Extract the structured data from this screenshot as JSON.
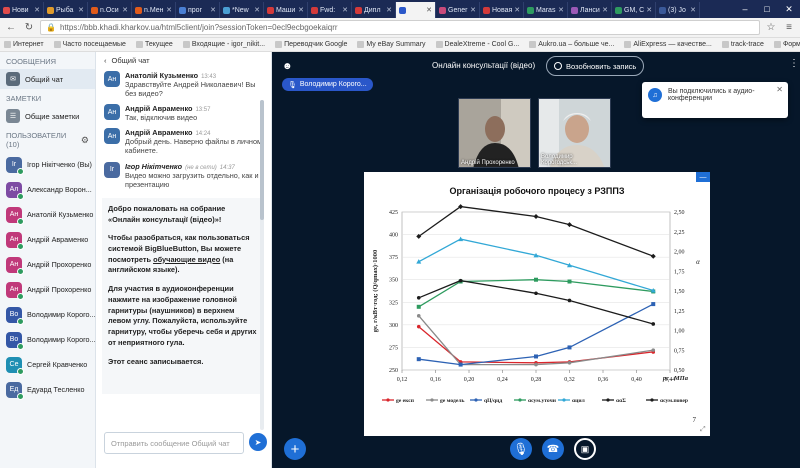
{
  "browser": {
    "tabs": [
      {
        "label": "Нови",
        "color": "#e04b4b"
      },
      {
        "label": "Рыба",
        "color": "#e09b2b"
      },
      {
        "label": "n.Оси",
        "color": "#e05b1b"
      },
      {
        "label": "n.Мен",
        "color": "#e05b1b"
      },
      {
        "label": "прог",
        "color": "#4a7fd3"
      },
      {
        "label": "*New",
        "color": "#4a9fd3"
      },
      {
        "label": "Маши",
        "color": "#d33a3a"
      },
      {
        "label": "Fwd:",
        "color": "#d33a3a"
      },
      {
        "label": "Дипл",
        "color": "#d33a3a"
      },
      {
        "label": "",
        "color": "#2a57c9",
        "active": true
      },
      {
        "label": "Gener",
        "color": "#c94a7a"
      },
      {
        "label": "Новая",
        "color": "#d33a3a"
      },
      {
        "label": "Maras",
        "color": "#2e9b5f"
      },
      {
        "label": "Ланси",
        "color": "#9b59b6"
      },
      {
        "label": "GM, С",
        "color": "#2e9b5f"
      },
      {
        "label": "(3) Jo",
        "color": "#3b5998"
      }
    ],
    "url": "https://bbb.khadi.kharkov.ua/html5client/join?sessionToken=0ecl9ecbgoekaiqrr",
    "bookmarks": [
      "Интернет",
      "Часто посещаемые",
      "Текущее",
      "Входящие - igor_nikit...",
      "Переводчик Google",
      "My eBay Summary",
      "DealeXtreme - Cool G...",
      "Aukro.ua – больше че...",
      "AliExpress — качестве...",
      "track-trace",
      "Форма пошуку | УКР..."
    ]
  },
  "sidebar": {
    "messages_title": "СООБЩЕНИЯ",
    "public_chat": "Общий чат",
    "notes_title": "ЗАМЕТКИ",
    "shared_notes": "Общие заметки",
    "users_title": "ПОЛЬЗОВАТЕЛИ (10)",
    "users": [
      {
        "initials": "Ir",
        "name": "Ігор Нікітченко (Вы)",
        "color": "#4a6aa0"
      },
      {
        "initials": "Ал",
        "name": "Александр Ворон...",
        "color": "#7d4ba3"
      },
      {
        "initials": "Ан",
        "name": "Анатолій Кузьменко",
        "color": "#c0397a"
      },
      {
        "initials": "Ан",
        "name": "Андрій Авраменко",
        "color": "#c0397a"
      },
      {
        "initials": "Ан",
        "name": "Андрій Прохоренко",
        "color": "#c0397a"
      },
      {
        "initials": "Ан",
        "name": "Андрій Прохоренко",
        "color": "#c0397a"
      },
      {
        "initials": "Во",
        "name": "Володимир Корого...",
        "color": "#3457a6"
      },
      {
        "initials": "Во",
        "name": "Володимир Корого...",
        "color": "#3457a6"
      },
      {
        "initials": "Се",
        "name": "Сергей Кравченко",
        "color": "#1f8fb3"
      },
      {
        "initials": "Ед",
        "name": "Едуард Тесленко",
        "color": "#4a6aa0"
      }
    ]
  },
  "chat": {
    "header": "Общий чат",
    "messages": [
      {
        "initials": "Ан",
        "name": "Анатолій Кузьменко",
        "time": "13:43",
        "text": "Здравствуйте Андрей Николаевич! Вы без видео?"
      },
      {
        "initials": "Ан",
        "name": "Андрій Авраменко",
        "time": "13:57",
        "text": "Так, відключив видео"
      },
      {
        "initials": "Ан",
        "name": "Андрій Авраменко",
        "time": "14:24",
        "text": "Добрый день. Наверно файлы в личном кабинете."
      },
      {
        "initials": "Ir",
        "name": "Ігор Нікітченко",
        "status": "(не в сети)",
        "time": "14:37",
        "text": "Видео можно загрузить отдельно, как и презентацию"
      }
    ],
    "welcome": {
      "p1": "Добро пожаловать на собрание «Онлайн консультації (відео)»!",
      "p2_before": "Чтобы разобраться, как пользоваться системой BigBlueButton, Вы можете посмотреть ",
      "p2_link": "обучающие видео",
      "p2_after": " (на английском языке).",
      "p3": "Для участия в аудиоконференции нажмите на изображение головной гарнитуры (наушников) в верхнем левом углу. Пожалуйста, используйте гарнитуру, чтобы уберечь себя и других от неприятного гула.",
      "p4": "Этот сеанс записывается."
    },
    "input_placeholder": "Отправить сообщение Общий чат"
  },
  "main": {
    "title": "Онлайн консультації (відео)",
    "record_label": "Возобновить запись",
    "presenter": "Володимир Корого...",
    "videos": [
      {
        "caption": "Андрій Прохоренко"
      },
      {
        "caption": "Володимир Корогодськ..."
      }
    ],
    "toast": "Вы подключились к аудио-конференции"
  },
  "slide": {
    "page_number": "7"
  },
  "chart_data": {
    "type": "line",
    "title": "Організація робочого процесу з РЗППЗ",
    "xlabel": "pc , МПа",
    "ylabel": "ge, г/кВт·год; (Q/qmax)·1000",
    "y2label": "α",
    "x": [
      0.14,
      0.19,
      0.28,
      0.32,
      0.42
    ],
    "xlim": [
      0.12,
      0.44
    ],
    "xticks": [
      "0,12",
      "0,16",
      "0,20",
      "0,24",
      "0,28",
      "0,32",
      "0,36",
      "0,40",
      "0,44"
    ],
    "ylim": [
      250,
      425
    ],
    "yticks": [
      "250",
      "275",
      "300",
      "325",
      "350",
      "375",
      "400",
      "425"
    ],
    "y2lim": [
      0.5,
      2.5
    ],
    "y2ticks": [
      "0,50",
      "0,75",
      "1,00",
      "1,25",
      "1,50",
      "1,75",
      "2,00",
      "2,25",
      "2,50"
    ],
    "series": [
      {
        "name": "ge експ",
        "color": "#d9262c",
        "marker": "circle",
        "x": [
          0.14,
          0.19,
          0.28,
          0.32,
          0.42
        ],
        "y": [
          298,
          259,
          258,
          259,
          270
        ]
      },
      {
        "name": "ge модель",
        "color": "#8a8a8a",
        "marker": "circle",
        "x": [
          0.14,
          0.19,
          0.28,
          0.32,
          0.42
        ],
        "y": [
          310,
          256,
          256,
          258,
          272
        ]
      },
      {
        "name": "qЦ/qцд",
        "color": "#2d62b4",
        "marker": "square",
        "x": [
          0.14,
          0.19,
          0.28,
          0.32,
          0.42
        ],
        "y": [
          262,
          256,
          265,
          275,
          323
        ]
      },
      {
        "name": "αсум.уточн",
        "color": "#2e9b5f",
        "marker": "square",
        "x": [
          0.14,
          0.19,
          0.28,
          0.32,
          0.42
        ],
        "y": [
          320,
          348,
          350,
          348,
          337
        ]
      },
      {
        "name": "αцил",
        "color": "#32a8d6",
        "marker": "triangle",
        "x": [
          0.14,
          0.19,
          0.28,
          0.32,
          0.42
        ],
        "y": [
          370,
          395,
          377,
          366,
          338
        ]
      },
      {
        "name": "ααΣ",
        "color": "#1c1c1c",
        "marker": "circle",
        "x": [
          0.14,
          0.19,
          0.28,
          0.32,
          0.42
        ],
        "y": [
          330,
          349,
          335,
          327,
          301
        ]
      },
      {
        "name": "αсум.повер",
        "color": "#1c1c1c",
        "marker": "diamond",
        "x": [
          0.14,
          0.19,
          0.28,
          0.32,
          0.42
        ],
        "y": [
          398,
          431,
          420,
          411,
          376
        ]
      }
    ]
  }
}
